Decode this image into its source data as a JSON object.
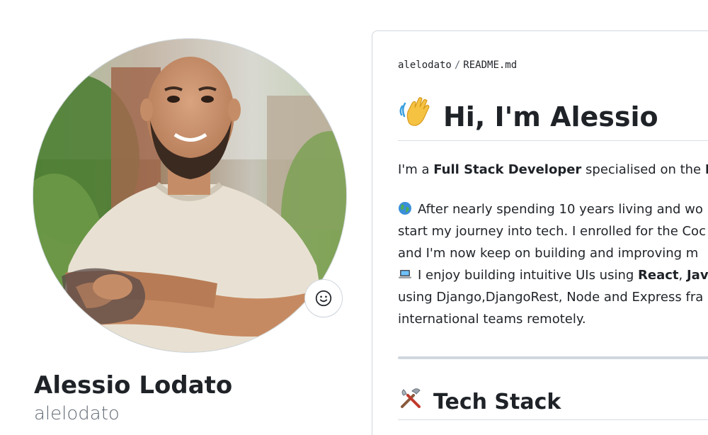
{
  "profile": {
    "full_name": "Alessio Lodato",
    "login": "alelodato",
    "status_icon": "smiley-icon",
    "avatar_alt": "Alessio Lodato avatar"
  },
  "readme": {
    "path_owner": "alelodato",
    "path_separator": "/",
    "path_file": "README.md",
    "heading_emoji": "waving-hand-icon",
    "heading": "Hi, I'm Alessio",
    "intro": {
      "prefix": "I'm a ",
      "role": "Full Stack Developer",
      "middle": " specialised on the ",
      "cut": "Fr"
    },
    "bio_lines": {
      "line1": "After nearly spending 10 years living and wo",
      "line2": "start my journey into tech. I enrolled for the Coc",
      "line3": "and I'm now keep on building and improving m",
      "line4_prefix": "I enjoy building intuitive UIs using ",
      "line4_react": "React",
      "line4_sep": ", ",
      "line4_js": "Jav",
      "line5": "using Django,DjangoRest, Node and Express fra",
      "line6": "international teams remotely."
    },
    "bio_emoji_1": "globe-icon",
    "bio_emoji_2": "laptop-icon",
    "tech_stack_emoji": "tools-icon",
    "tech_stack_heading": "Tech Stack"
  },
  "colors": {
    "text": "#1f2328",
    "muted": "#636c76",
    "border": "#d0d7de"
  }
}
